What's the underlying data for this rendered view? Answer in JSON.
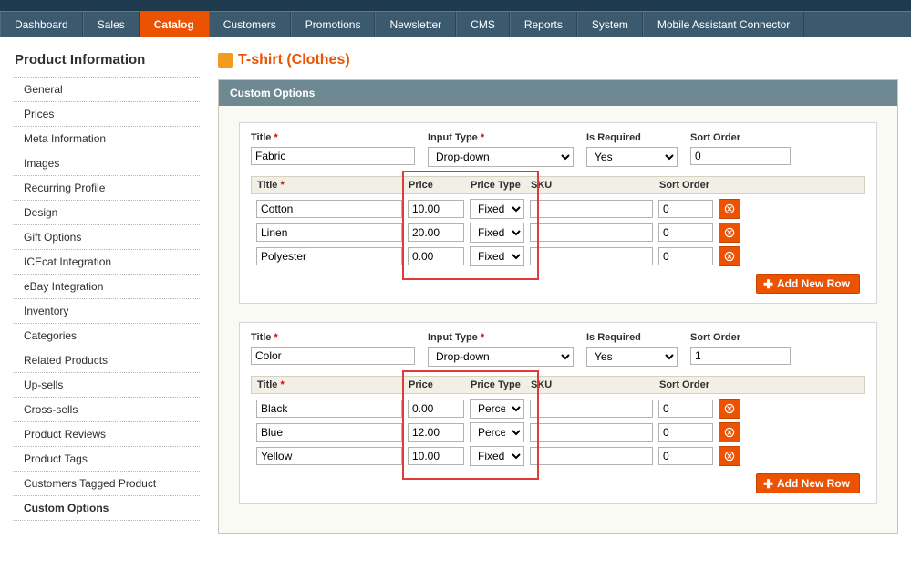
{
  "nav": {
    "items": [
      {
        "label": "Dashboard"
      },
      {
        "label": "Sales"
      },
      {
        "label": "Catalog"
      },
      {
        "label": "Customers"
      },
      {
        "label": "Promotions"
      },
      {
        "label": "Newsletter"
      },
      {
        "label": "CMS"
      },
      {
        "label": "Reports"
      },
      {
        "label": "System"
      },
      {
        "label": "Mobile Assistant Connector"
      }
    ],
    "active_index": 2
  },
  "sidebar": {
    "title": "Product Information",
    "items": [
      {
        "label": "General"
      },
      {
        "label": "Prices"
      },
      {
        "label": "Meta Information"
      },
      {
        "label": "Images"
      },
      {
        "label": "Recurring Profile"
      },
      {
        "label": "Design"
      },
      {
        "label": "Gift Options"
      },
      {
        "label": "ICEcat Integration"
      },
      {
        "label": "eBay Integration"
      },
      {
        "label": "Inventory"
      },
      {
        "label": "Categories"
      },
      {
        "label": "Related Products"
      },
      {
        "label": "Up-sells"
      },
      {
        "label": "Cross-sells"
      },
      {
        "label": "Product Reviews"
      },
      {
        "label": "Product Tags"
      },
      {
        "label": "Customers Tagged Product"
      },
      {
        "label": "Custom Options"
      }
    ],
    "active_index": 17
  },
  "page": {
    "title": "T-shirt (Clothes)"
  },
  "panel": {
    "title": "Custom Options"
  },
  "labels": {
    "title": "Title",
    "input_type": "Input Type",
    "is_required": "Is Required",
    "sort_order": "Sort Order",
    "price": "Price",
    "price_type": "Price Type",
    "sku": "SKU",
    "add_row": "Add New Row"
  },
  "options": [
    {
      "title": "Fabric",
      "input_type": "Drop-down",
      "is_required": "Yes",
      "sort_order": "0",
      "rows": [
        {
          "title": "Cotton",
          "price": "10.00",
          "price_type": "Fixed",
          "sku": "",
          "sort_order": "0"
        },
        {
          "title": "Linen",
          "price": "20.00",
          "price_type": "Fixed",
          "sku": "",
          "sort_order": "0"
        },
        {
          "title": "Polyester",
          "price": "0.00",
          "price_type": "Fixed",
          "sku": "",
          "sort_order": "0"
        }
      ]
    },
    {
      "title": "Color",
      "input_type": "Drop-down",
      "is_required": "Yes",
      "sort_order": "1",
      "rows": [
        {
          "title": "Black",
          "price": "0.00",
          "price_type": "Percent",
          "sku": "",
          "sort_order": "0"
        },
        {
          "title": "Blue",
          "price": "12.00",
          "price_type": "Percent",
          "sku": "",
          "sort_order": "0"
        },
        {
          "title": "Yellow",
          "price": "10.00",
          "price_type": "Fixed",
          "sku": "",
          "sort_order": "0"
        }
      ]
    }
  ]
}
